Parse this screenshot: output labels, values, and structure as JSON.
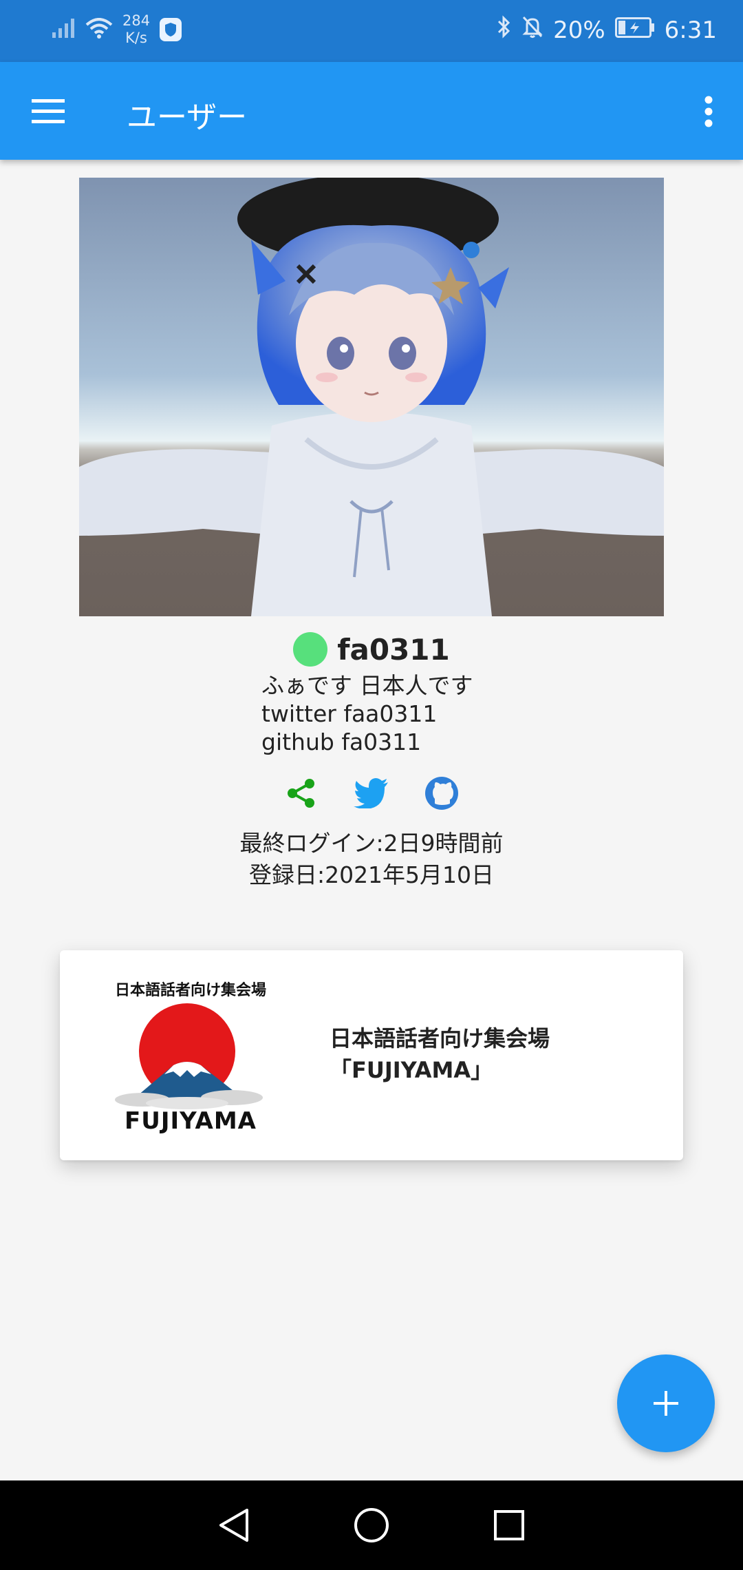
{
  "status_bar": {
    "net_speed_value": "284",
    "net_speed_unit": "K/s",
    "battery": "20%",
    "time": "6:31"
  },
  "app_bar": {
    "title": "ユーザー"
  },
  "profile": {
    "username": "fa0311",
    "status_color": "#57e07c",
    "bio_lines": [
      "ふぁです 日本人です",
      "twitter faa0311",
      "github fa0311"
    ],
    "last_login": "最終ログイン:2日9時間前",
    "registered": "登録日:2021年5月10日",
    "social_icons": [
      "share-icon",
      "twitter-icon",
      "github-icon"
    ]
  },
  "group": {
    "logo_caption": "日本語話者向け集会場",
    "logo_word": "FUJIYAMA",
    "name_line1": "日本語話者向け集会場",
    "name_line2": "「FUJIYAMA」"
  },
  "colors": {
    "status_bar": "#1f7ad0",
    "app_bar": "#2196f3",
    "fab": "#2196f3",
    "share_icon": "#19a319",
    "twitter_icon": "#1da1f2",
    "github_icon": "#2f7fd8"
  }
}
